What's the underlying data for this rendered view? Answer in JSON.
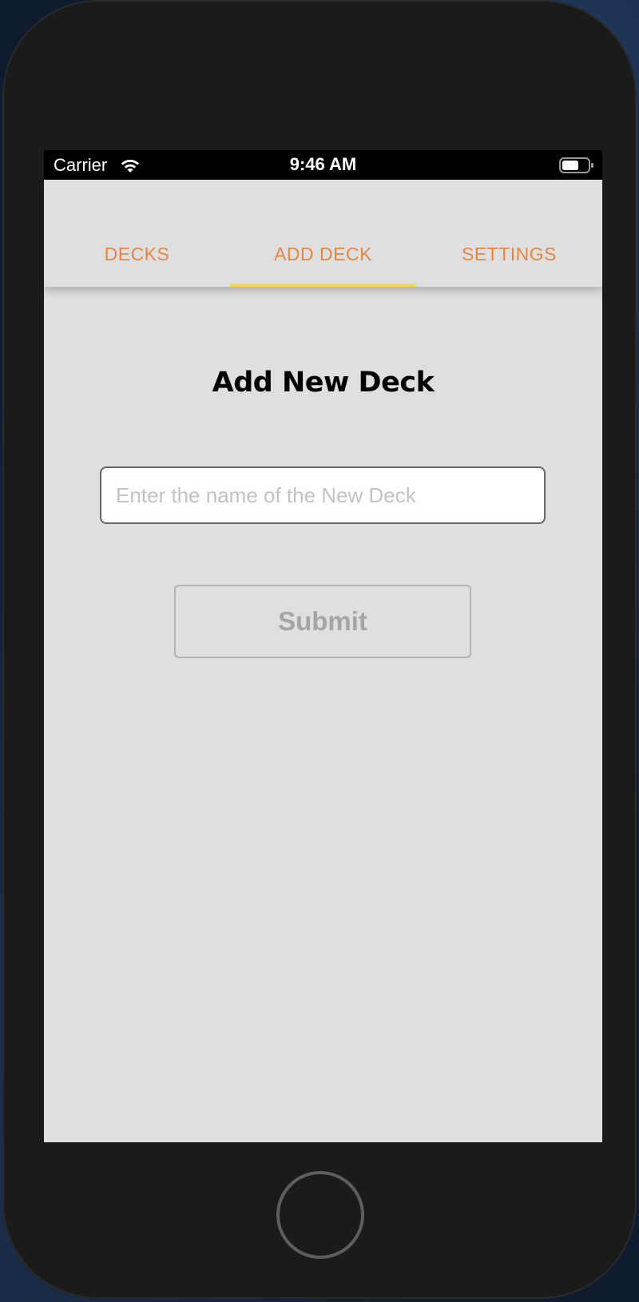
{
  "status_bar": {
    "carrier": "Carrier",
    "time": "9:46 AM",
    "wifi_icon": "wifi-icon",
    "battery_icon": "battery-icon"
  },
  "tabs": [
    {
      "label": "DECKS",
      "selected": false
    },
    {
      "label": "ADD DECK",
      "selected": true
    },
    {
      "label": "SETTINGS",
      "selected": false
    }
  ],
  "main": {
    "title": "Add New Deck",
    "deck_name_input": {
      "value": "",
      "placeholder": "Enter the name of the New Deck"
    },
    "submit_label": "Submit"
  },
  "colors": {
    "tab_text": "#e58743",
    "tab_indicator": "#f5d84d",
    "screen_bg": "#dfdfdf",
    "submit_disabled": "#a5a5a5"
  }
}
